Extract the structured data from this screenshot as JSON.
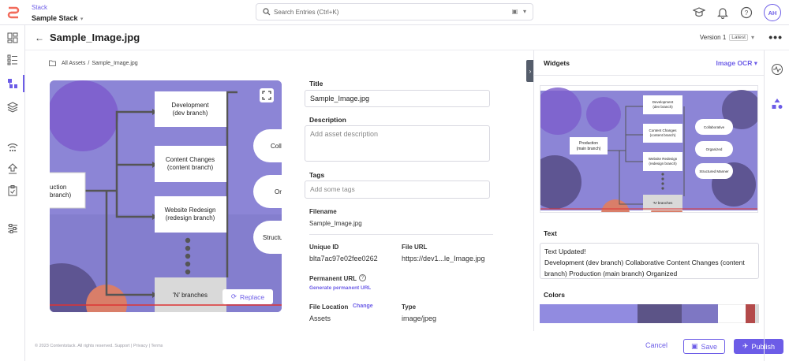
{
  "topbar": {
    "stack_label": "Stack",
    "stack_name": "Sample Stack",
    "search_placeholder": "Search Entries (Ctrl+K)",
    "avatar_initials": "AH"
  },
  "header": {
    "title": "Sample_Image.jpg",
    "version": "Version 1",
    "latest": "Latest"
  },
  "breadcrumb": {
    "root": "All Assets",
    "sep": "/",
    "current": "Sample_Image.jpg"
  },
  "preview": {
    "nodes": {
      "production": [
        "uction",
        "branch)"
      ],
      "development": [
        "Development",
        "(dev branch)"
      ],
      "content": [
        "Content Changes",
        "(content branch)"
      ],
      "website": [
        "Website Redesign",
        "(redesign branch)"
      ],
      "nbranches": "'N' branches",
      "collab": "Coll",
      "organized": "Or",
      "structured": "Structu"
    },
    "replace_label": "Replace"
  },
  "form": {
    "title_label": "Title",
    "title_value": "Sample_Image.jpg",
    "description_label": "Description",
    "description_placeholder": "Add asset description",
    "tags_label": "Tags",
    "tags_placeholder": "Add some tags",
    "filename_label": "Filename",
    "filename_value": "Sample_Image.jpg",
    "uid_label": "Unique ID",
    "uid_value": "blta7ac97e02fee0262",
    "fileurl_label": "File URL",
    "fileurl_value": "https://dev1...le_Image.jpg",
    "permanent_label": "Permanent URL",
    "permanent_link": "Generate permanent URL",
    "location_label": "File Location",
    "location_change": "Change",
    "location_value": "Assets",
    "type_label": "Type",
    "type_value": "image/jpeg"
  },
  "footer": "© 2023 Contentstack. All rights reserved. Support | Privacy | Terms",
  "actions": {
    "cancel": "Cancel",
    "save": "Save",
    "publish": "Publish"
  },
  "widgets": {
    "title": "Widgets",
    "selected": "Image OCR",
    "ocr_nodes": {
      "production": [
        "Production",
        "(main branch)"
      ],
      "development": [
        "Development",
        "(dev branch)"
      ],
      "content": [
        "Content Changes",
        "(content branch)"
      ],
      "website": [
        "Website Redesign",
        "(redesign branch)"
      ],
      "nbranches": "'N' branches",
      "collab": "Collaborative",
      "organized": "Organized",
      "structured": "Structured Manner"
    },
    "text_label": "Text",
    "text_line1": "Text Updated!",
    "text_line2": "Development (dev branch) Collaborative Content Changes (content branch) Production (main branch) Organized",
    "colors_label": "Colors",
    "palette": [
      "#918be0",
      "#5c5487",
      "#7e77c3",
      "#ffffff",
      "#b34a4a",
      "#d9d9d9"
    ]
  },
  "icons": [
    "logo-icon",
    "search-icon",
    "calendar-icon",
    "chevron-down-icon",
    "learning-icon",
    "bell-icon",
    "help-icon",
    "dashboard-icon",
    "list-icon",
    "content-icon",
    "layers-icon",
    "wifi-icon",
    "upload-icon",
    "clipboard-icon",
    "settings-sliders-icon",
    "back-arrow-icon",
    "more-icon",
    "expand-icon",
    "refresh-icon",
    "save-icon",
    "publish-icon",
    "activity-icon",
    "shapes-icon",
    "help-circle-icon"
  ]
}
